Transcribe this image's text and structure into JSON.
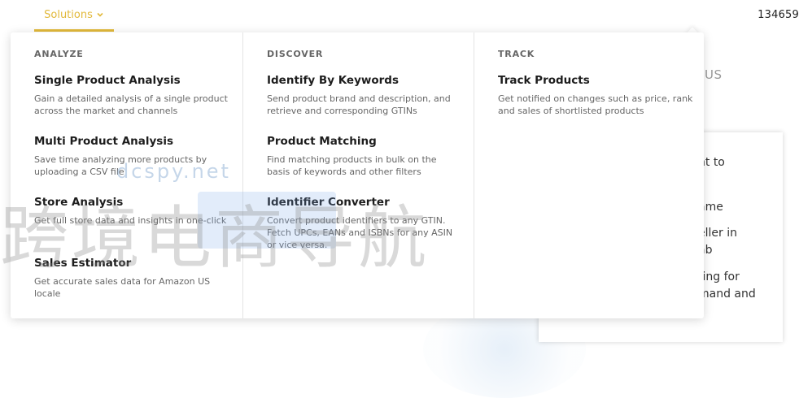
{
  "topbar": {
    "solutions_label": "Solutions",
    "counter": "134659"
  },
  "background": {
    "partial_us": "US",
    "card_lines": [
      "nt to",
      "ame",
      "eller in",
      "ab",
      "ting for",
      "mand and"
    ]
  },
  "watermark": {
    "url_text": "dcspy.net",
    "cn_text": "跨境电商导航"
  },
  "dropdown": {
    "columns": [
      {
        "heading": "ANALYZE",
        "items": [
          {
            "title": "Single Product Analysis",
            "desc": "Gain a detailed analysis of a single product across the market and channels"
          },
          {
            "title": "Multi Product Analysis",
            "desc": "Save time analyzing more products by uploading a CSV file"
          },
          {
            "title": "Store Analysis",
            "desc": "Get full store data and insights in one-click"
          },
          {
            "title": "Sales Estimator",
            "desc": "Get accurate sales data for Amazon US locale"
          }
        ]
      },
      {
        "heading": "DISCOVER",
        "items": [
          {
            "title": "Identify By Keywords",
            "desc": "Send product brand and description, and retrieve and corresponding GTINs"
          },
          {
            "title": "Product Matching",
            "desc": "Find matching products in bulk on the basis of keywords and other filters"
          },
          {
            "title": "Identifier Converter",
            "desc": "Convert product identifiers to any GTIN. Fetch UPCs, EANs and ISBNs for any ASIN or vice versa."
          }
        ]
      },
      {
        "heading": "TRACK",
        "items": [
          {
            "title": "Track Products",
            "desc": "Get notified on changes such as price, rank and sales of shortlisted products"
          }
        ]
      }
    ]
  },
  "colors": {
    "accent": "#e2b93b",
    "heading": "#666666",
    "title": "#1d1d1d"
  }
}
